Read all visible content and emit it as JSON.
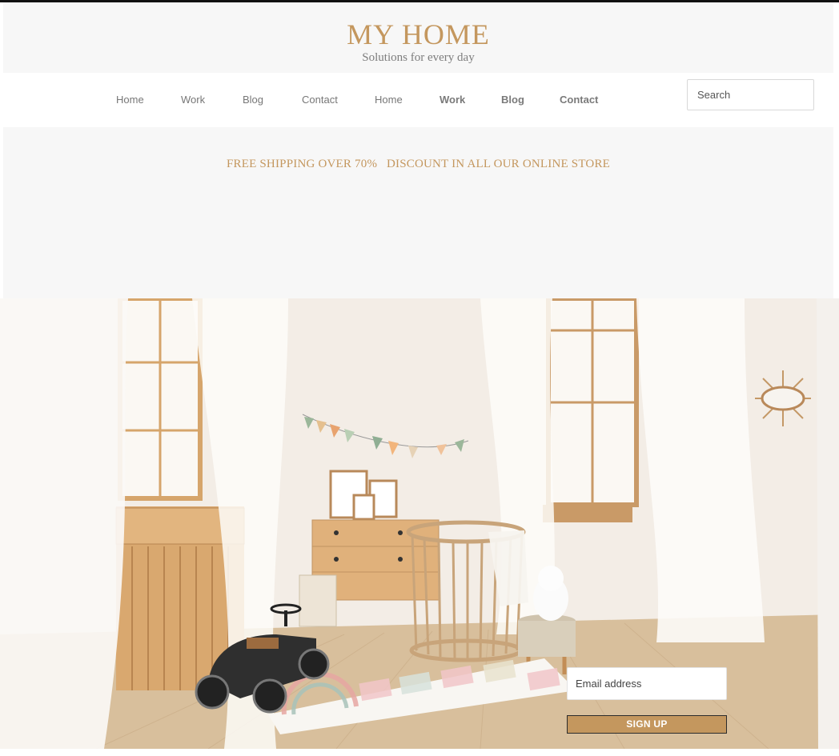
{
  "brand": {
    "title": "MY HOME",
    "tagline": "Solutions for every day",
    "accent_color": "#c4975e"
  },
  "nav": {
    "items": [
      {
        "label": "Home",
        "bold": false
      },
      {
        "label": "Work",
        "bold": false
      },
      {
        "label": "Blog",
        "bold": false
      },
      {
        "label": "Contact",
        "bold": false
      },
      {
        "label": "Home",
        "bold": false
      },
      {
        "label": "Work",
        "bold": true
      },
      {
        "label": "Blog",
        "bold": true
      },
      {
        "label": "Contact",
        "bold": true
      }
    ],
    "search_placeholder": "Search"
  },
  "promo": {
    "text": "FREE SHIPPING OVER 70%   DISCOUNT IN ALL OUR ONLINE STORE"
  },
  "hero": {
    "image": "nursery-room-photo"
  },
  "newsletter": {
    "email_placeholder": "Email address",
    "button_label": "SIGN UP"
  }
}
